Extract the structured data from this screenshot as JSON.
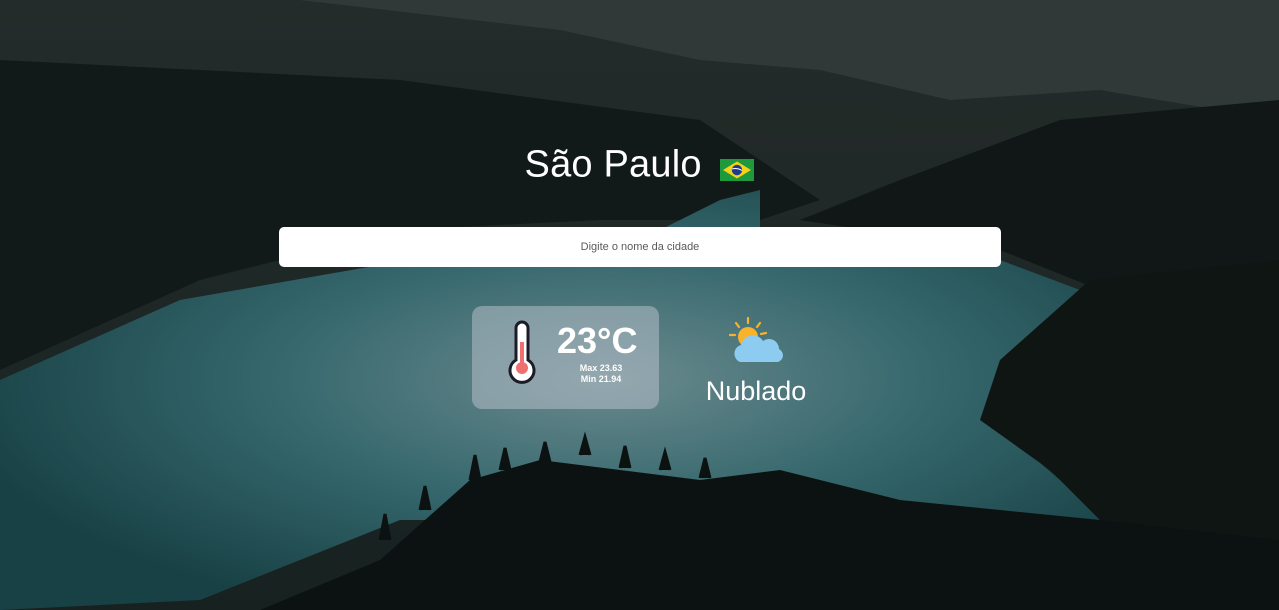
{
  "location": {
    "city": "São Paulo",
    "country_flag_icon": "brazil-flag-icon"
  },
  "search": {
    "placeholder": "Digite o nome da cidade",
    "value": ""
  },
  "temperature": {
    "current": "23°C",
    "max": "Max 23.63",
    "min": "Min 21.94",
    "icon": "thermometer-icon"
  },
  "condition": {
    "label": "Nublado",
    "icon": "partly-cloudy-icon"
  },
  "colors": {
    "card_bg": "rgba(180,190,200,0.55)",
    "thermo_red": "#f07070",
    "sun": "#f9b32b",
    "cloud": "#8ecbf0"
  }
}
